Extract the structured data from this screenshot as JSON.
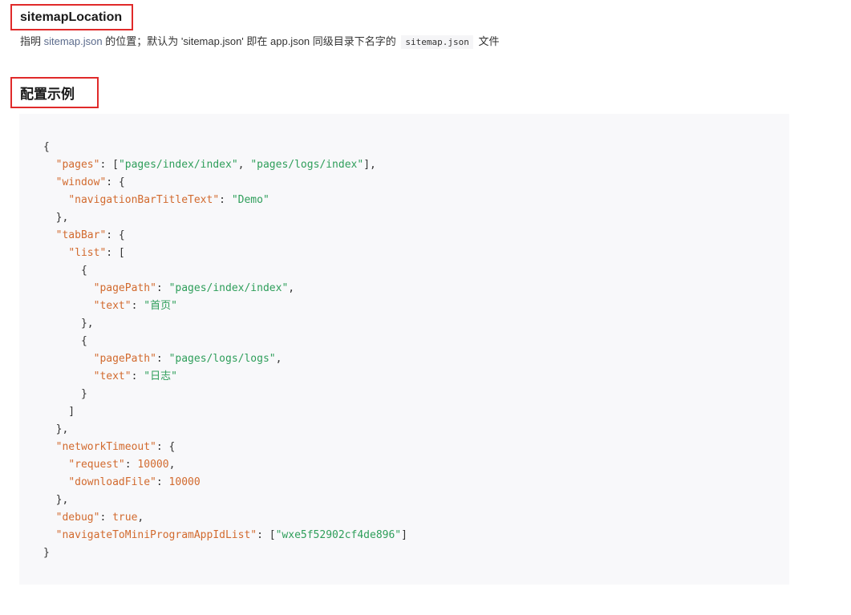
{
  "section1": {
    "title": "sitemapLocation",
    "desc_prefix": "指明 ",
    "desc_link": "sitemap.json",
    "desc_mid": " 的位置；默认为 'sitemap.json' 即在 app.json 同级目录下名字的 ",
    "desc_code": "sitemap.json",
    "desc_suffix": " 文件"
  },
  "section2": {
    "title": "配置示例"
  },
  "code": {
    "lines": [
      [
        {
          "t": "p",
          "v": "{"
        }
      ],
      [
        {
          "t": "p",
          "v": "  "
        },
        {
          "t": "k",
          "v": "\"pages\""
        },
        {
          "t": "p",
          "v": ": ["
        },
        {
          "t": "s",
          "v": "\"pages/index/index\""
        },
        {
          "t": "p",
          "v": ", "
        },
        {
          "t": "s",
          "v": "\"pages/logs/index\""
        },
        {
          "t": "p",
          "v": "],"
        }
      ],
      [
        {
          "t": "p",
          "v": "  "
        },
        {
          "t": "k",
          "v": "\"window\""
        },
        {
          "t": "p",
          "v": ": {"
        }
      ],
      [
        {
          "t": "p",
          "v": "    "
        },
        {
          "t": "k",
          "v": "\"navigationBarTitleText\""
        },
        {
          "t": "p",
          "v": ": "
        },
        {
          "t": "s",
          "v": "\"Demo\""
        }
      ],
      [
        {
          "t": "p",
          "v": "  },"
        }
      ],
      [
        {
          "t": "p",
          "v": "  "
        },
        {
          "t": "k",
          "v": "\"tabBar\""
        },
        {
          "t": "p",
          "v": ": {"
        }
      ],
      [
        {
          "t": "p",
          "v": "    "
        },
        {
          "t": "k",
          "v": "\"list\""
        },
        {
          "t": "p",
          "v": ": ["
        }
      ],
      [
        {
          "t": "p",
          "v": "      {"
        }
      ],
      [
        {
          "t": "p",
          "v": "        "
        },
        {
          "t": "k",
          "v": "\"pagePath\""
        },
        {
          "t": "p",
          "v": ": "
        },
        {
          "t": "s",
          "v": "\"pages/index/index\""
        },
        {
          "t": "p",
          "v": ","
        }
      ],
      [
        {
          "t": "p",
          "v": "        "
        },
        {
          "t": "k",
          "v": "\"text\""
        },
        {
          "t": "p",
          "v": ": "
        },
        {
          "t": "s",
          "v": "\"首页\""
        }
      ],
      [
        {
          "t": "p",
          "v": "      },"
        }
      ],
      [
        {
          "t": "p",
          "v": "      {"
        }
      ],
      [
        {
          "t": "p",
          "v": "        "
        },
        {
          "t": "k",
          "v": "\"pagePath\""
        },
        {
          "t": "p",
          "v": ": "
        },
        {
          "t": "s",
          "v": "\"pages/logs/logs\""
        },
        {
          "t": "p",
          "v": ","
        }
      ],
      [
        {
          "t": "p",
          "v": "        "
        },
        {
          "t": "k",
          "v": "\"text\""
        },
        {
          "t": "p",
          "v": ": "
        },
        {
          "t": "s",
          "v": "\"日志\""
        }
      ],
      [
        {
          "t": "p",
          "v": "      }"
        }
      ],
      [
        {
          "t": "p",
          "v": "    ]"
        }
      ],
      [
        {
          "t": "p",
          "v": "  },"
        }
      ],
      [
        {
          "t": "p",
          "v": "  "
        },
        {
          "t": "k",
          "v": "\"networkTimeout\""
        },
        {
          "t": "p",
          "v": ": {"
        }
      ],
      [
        {
          "t": "p",
          "v": "    "
        },
        {
          "t": "k",
          "v": "\"request\""
        },
        {
          "t": "p",
          "v": ": "
        },
        {
          "t": "n",
          "v": "10000"
        },
        {
          "t": "p",
          "v": ","
        }
      ],
      [
        {
          "t": "p",
          "v": "    "
        },
        {
          "t": "k",
          "v": "\"downloadFile\""
        },
        {
          "t": "p",
          "v": ": "
        },
        {
          "t": "n",
          "v": "10000"
        }
      ],
      [
        {
          "t": "p",
          "v": "  },"
        }
      ],
      [
        {
          "t": "p",
          "v": "  "
        },
        {
          "t": "k",
          "v": "\"debug\""
        },
        {
          "t": "p",
          "v": ": "
        },
        {
          "t": "n",
          "v": "true"
        },
        {
          "t": "p",
          "v": ","
        }
      ],
      [
        {
          "t": "p",
          "v": "  "
        },
        {
          "t": "k",
          "v": "\"navigateToMiniProgramAppIdList\""
        },
        {
          "t": "p",
          "v": ": ["
        },
        {
          "t": "s",
          "v": "\"wxe5f52902cf4de896\""
        },
        {
          "t": "p",
          "v": "]"
        }
      ],
      [
        {
          "t": "p",
          "v": "}"
        }
      ]
    ]
  },
  "colors": {
    "highlight_border": "#e02a2a",
    "json_key": "#d26a2e",
    "json_string": "#2e9e5a",
    "code_background": "#f8f8fa"
  }
}
